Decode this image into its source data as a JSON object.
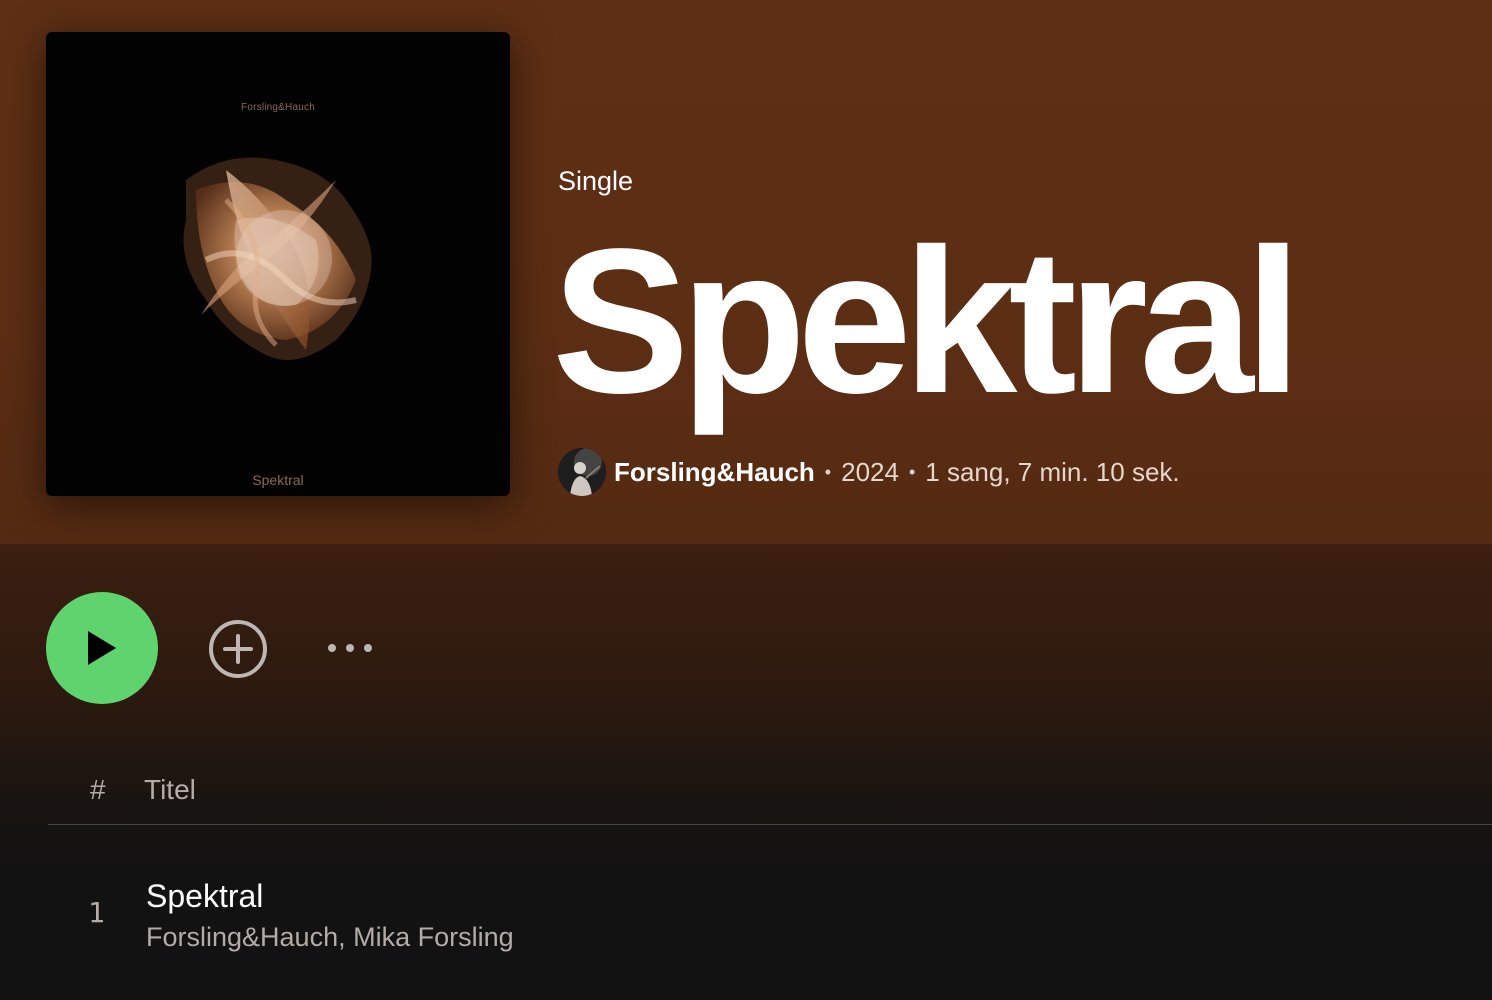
{
  "album": {
    "cover_artist_text": "Forsling&Hauch",
    "cover_title_text": "Spektral",
    "type_label": "Single",
    "title": "Spektral",
    "artist": "Forsling&Hauch",
    "year": "2024",
    "summary": "1 sang, 7 min. 10 sek.",
    "separator": "•"
  },
  "actions": {
    "play_icon": "play-icon",
    "add_icon": "add-circle-icon",
    "more_icon": "more-options-icon",
    "play_color": "#5fd46e"
  },
  "tracklist": {
    "header_num": "#",
    "header_title": "Titel",
    "tracks": [
      {
        "number": "1",
        "title": "Spektral",
        "artists": "Forsling&Hauch, Mika Forsling"
      }
    ]
  },
  "colors": {
    "header_bg": "#5e2f14",
    "page_bg": "#121212",
    "accent": "#5fd46e"
  }
}
